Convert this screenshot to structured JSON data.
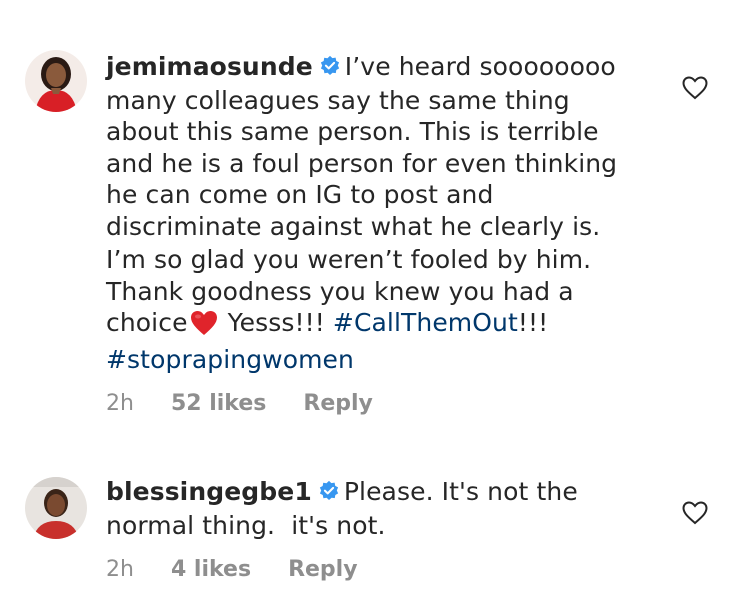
{
  "comments": [
    {
      "username": "jemimaosunde",
      "verified": true,
      "text_lines": [
        "I’ve heard soooooooo",
        "many colleagues say the same thing",
        "about this same person. This is terrible",
        "and he is a foul person for even thinking",
        "he can come on IG to post and",
        "discriminate against what he clearly is.",
        "I’m so glad you weren’t fooled by him.",
        "Thank goodness you knew you had a",
        "choice"
      ],
      "after_emoji": "Yesss!!!",
      "hashtag1": "#CallThemOut",
      "hashtag1_suffix": "!!!",
      "hashtag2": "#stoprapingwomen",
      "time": "2h",
      "likes": "52 likes",
      "reply": "Reply",
      "emoji": "red-heart"
    },
    {
      "username": "blessingegbe1",
      "verified": true,
      "text_lines": [
        "Please. It's not the",
        "normal thing.  it's not."
      ],
      "time": "2h",
      "likes": "4 likes",
      "reply": "Reply"
    }
  ],
  "colors": {
    "text": "#262626",
    "meta": "#8e8e8e",
    "hashtag": "#00376b",
    "verified": "#3897f0",
    "heart_emoji": "#e0242b"
  }
}
